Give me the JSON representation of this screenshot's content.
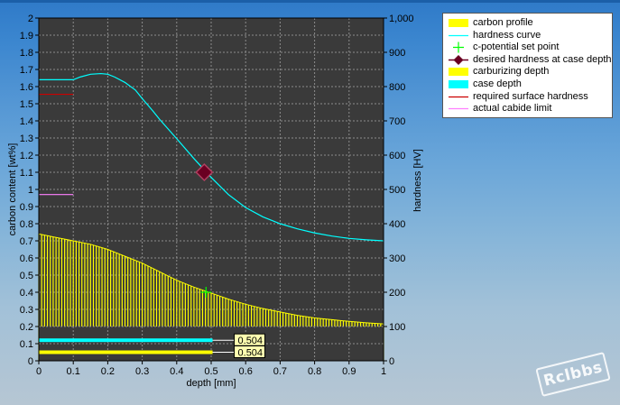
{
  "chart_data": {
    "type": "line",
    "xlabel": "depth [mm]",
    "ylabel_left": "carbon content [wt%]",
    "ylabel_right": "hardness [HV]",
    "xlim": [
      0,
      1
    ],
    "ylim_left": [
      0,
      2
    ],
    "ylim_right": [
      0,
      1000
    ],
    "x_ticks": [
      "0",
      "0.1",
      "0.2",
      "0.3",
      "0.4",
      "0.5",
      "0.6",
      "0.7",
      "0.8",
      "0.9",
      "1"
    ],
    "y_left_ticks": [
      "0",
      "0.1",
      "0.2",
      "0.3",
      "0.4",
      "0.5",
      "0.6",
      "0.7",
      "0.8",
      "0.9",
      "1",
      "1.1",
      "1.2",
      "1.3",
      "1.4",
      "1.5",
      "1.6",
      "1.7",
      "1.8",
      "1.9",
      "2"
    ],
    "y_right_ticks": [
      "0",
      "100",
      "200",
      "300",
      "400",
      "500",
      "600",
      "700",
      "800",
      "900",
      "1,000"
    ],
    "grid": true,
    "legend_position": "top-right, outside plot",
    "colors": {
      "plot_background": "#3a3a3a",
      "grid": "#8c8c8c",
      "carbon_profile": "#ffff00",
      "hardness_curve": "#00ffff",
      "set_point": "#00ff00",
      "desired_hardness": "#6a0022",
      "carburizing_depth": "#ffff00",
      "case_depth": "#00ffff",
      "surface_hardness": "#cc0000",
      "carbide_limit": "#ff80ff"
    },
    "series": [
      {
        "name": "carbon profile",
        "axis": "left",
        "x": [
          0,
          0.05,
          0.1,
          0.15,
          0.2,
          0.25,
          0.3,
          0.35,
          0.4,
          0.45,
          0.5,
          0.55,
          0.6,
          0.65,
          0.7,
          0.75,
          0.8,
          0.85,
          0.9,
          0.95,
          1.0
        ],
        "y": [
          0.74,
          0.72,
          0.7,
          0.68,
          0.65,
          0.61,
          0.57,
          0.52,
          0.47,
          0.43,
          0.395,
          0.36,
          0.33,
          0.305,
          0.285,
          0.265,
          0.25,
          0.24,
          0.23,
          0.222,
          0.215
        ]
      },
      {
        "name": "hardness curve",
        "axis": "right",
        "x": [
          0,
          0.1,
          0.12,
          0.15,
          0.18,
          0.2,
          0.22,
          0.25,
          0.28,
          0.3,
          0.33,
          0.35,
          0.4,
          0.45,
          0.5,
          0.55,
          0.6,
          0.65,
          0.7,
          0.75,
          0.8,
          0.85,
          0.9,
          0.95,
          1.0
        ],
        "y": [
          820,
          820,
          828,
          836,
          838,
          836,
          828,
          812,
          790,
          765,
          730,
          705,
          648,
          590,
          535,
          485,
          447,
          420,
          400,
          385,
          373,
          364,
          357,
          353,
          350
        ]
      },
      {
        "name": "c-potential set point",
        "axis": "left",
        "x": [
          0.485
        ],
        "y": [
          0.4
        ]
      },
      {
        "name": "desired hardness at case depth",
        "axis": "right",
        "x": [
          0.48
        ],
        "y": [
          550
        ]
      },
      {
        "name": "required surface hardness",
        "axis": "left",
        "x": [
          0,
          0.1
        ],
        "y": [
          1.555,
          1.555
        ]
      },
      {
        "name": "actual cabide limit",
        "axis": "left",
        "x": [
          0,
          0.1
        ],
        "y": [
          0.97,
          0.97
        ]
      },
      {
        "name": "carburizing depth",
        "axis": "left",
        "bar_value": 0.504
      },
      {
        "name": "case depth",
        "axis": "left",
        "bar_value": 0.504
      }
    ]
  },
  "legend": {
    "items": [
      {
        "label": "carbon profile",
        "symbol": "box",
        "color": "#ffff00"
      },
      {
        "label": "hardness curve",
        "symbol": "line",
        "color": "#00ffff"
      },
      {
        "label": "c-potential set point",
        "symbol": "plus",
        "color": "#00ff00"
      },
      {
        "label": "desired hardness at case depth",
        "symbol": "diamond",
        "color": "#6a0022"
      },
      {
        "label": "carburizing depth",
        "symbol": "box",
        "color": "#ffff00"
      },
      {
        "label": "case depth",
        "symbol": "box",
        "color": "#00ffff"
      },
      {
        "label": "required surface hardness",
        "symbol": "line",
        "color": "#cc0000"
      },
      {
        "label": "actual cabide limit",
        "symbol": "line",
        "color": "#ff80ff"
      }
    ]
  },
  "case_depth_labels": [
    "0.504",
    "0.504"
  ],
  "watermark": "Rclbbs"
}
